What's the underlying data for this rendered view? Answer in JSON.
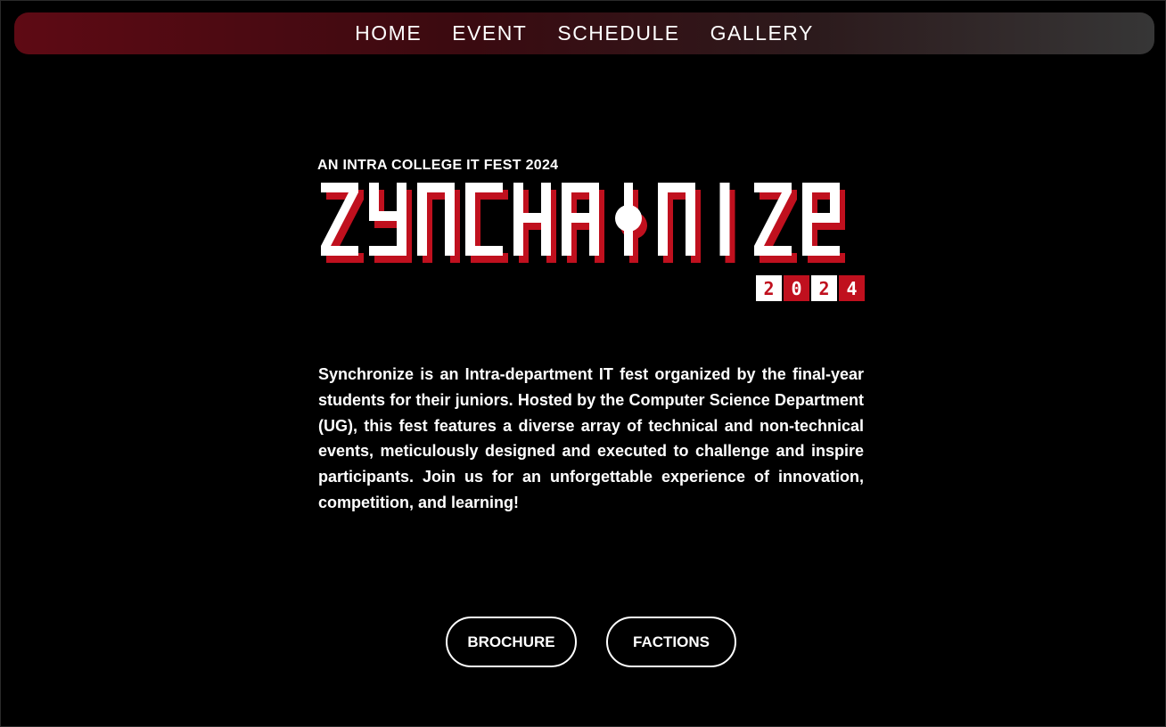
{
  "nav": {
    "items": [
      {
        "label": "HOME"
      },
      {
        "label": "EVENT"
      },
      {
        "label": "SCHEDULE"
      },
      {
        "label": "GALLERY"
      }
    ]
  },
  "hero": {
    "tagline": "AN INTRA COLLEGE IT FEST 2024",
    "logo_text": "SYNCHRONIZE",
    "logo_year": "2024",
    "description": "Synchronize is an Intra-department IT fest organized by the final-year students for their juniors. Hosted by the Computer Science Department (UG), this fest features a diverse array of technical and non-technical events, meticulously designed and executed to challenge and inspire participants. Join us for an unforgettable experience of innovation, competition, and learning!"
  },
  "actions": {
    "brochure_label": "BROCHURE",
    "factions_label": "FACTIONS"
  },
  "colors": {
    "background": "#000000",
    "accent_red": "#c0101e",
    "nav_gradient_start": "#5e0a14",
    "nav_gradient_end": "#363636",
    "text": "#ffffff"
  }
}
